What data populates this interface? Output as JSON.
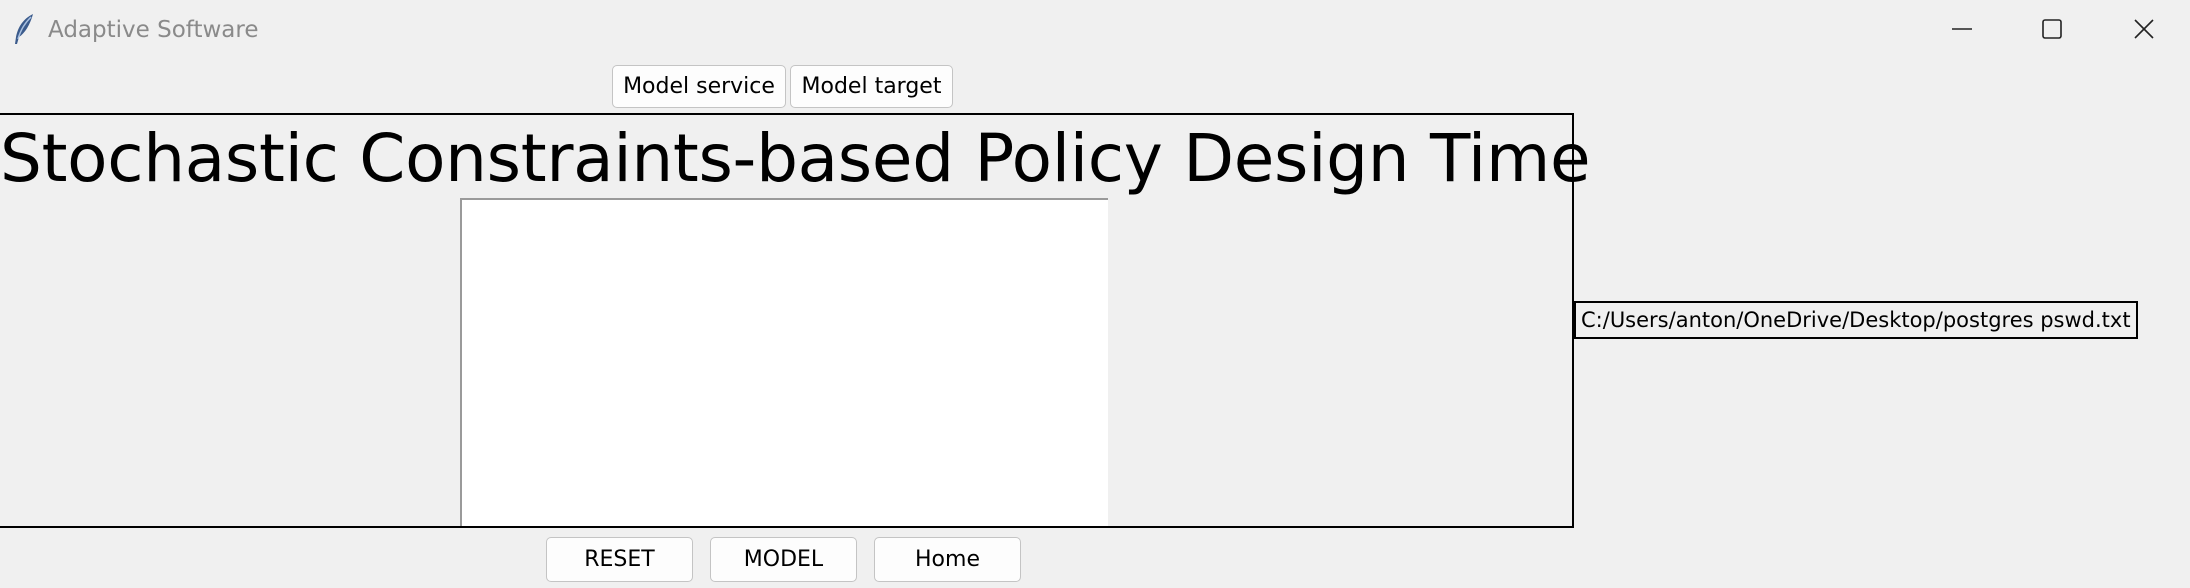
{
  "window": {
    "title": "Adaptive Software",
    "icon": "feather-icon",
    "controls": [
      "minimize-icon",
      "maximize-icon",
      "close-icon"
    ]
  },
  "top_buttons": {
    "model_service": "Model service",
    "model_target": "Model target"
  },
  "main": {
    "headline": "Stochastic Constraints-based Policy Design Time"
  },
  "file_path": "C:/Users/anton/OneDrive/Desktop/postgres pswd.txt",
  "bottom_buttons": {
    "reset": "RESET",
    "model": "MODEL",
    "home": "Home"
  },
  "colors": {
    "background": "#f0f0f0",
    "title_text": "#8a8a8a",
    "canvas": "#ffffff",
    "border": "#000000"
  }
}
